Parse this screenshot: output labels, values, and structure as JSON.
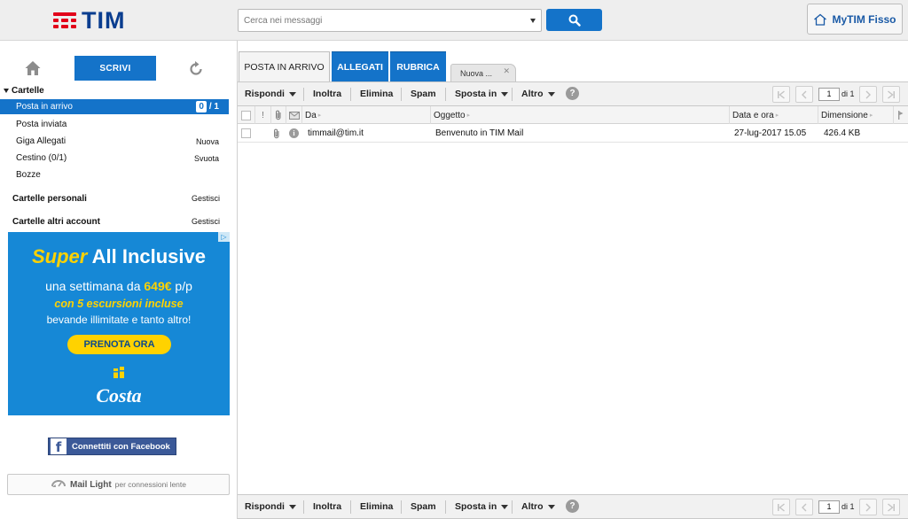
{
  "header": {
    "logo_text": "TIM",
    "search_placeholder": "Cerca nei messaggi",
    "mytim_label": "MyTIM Fisso",
    "brand_color": "#0a3d8f",
    "accent_color": "#1473c9"
  },
  "sidebar": {
    "write_label": "SCRIVI",
    "folders_title": "Cartelle",
    "folders": [
      {
        "label": "Posta in arrivo",
        "unread": "0",
        "total": "/ 1",
        "selected": true
      },
      {
        "label": "Posta inviata",
        "action": ""
      },
      {
        "label": "Giga Allegati",
        "action": "Nuova"
      },
      {
        "label": "Cestino (0/1)",
        "action": "Svuota"
      },
      {
        "label": "Bozze",
        "action": ""
      }
    ],
    "personal_folders": {
      "label": "Cartelle personali",
      "action": "Gestisci"
    },
    "other_accounts": {
      "label": "Cartelle altri account",
      "action": "Gestisci"
    },
    "ad": {
      "title_super": "Super",
      "title_rest": " All Inclusive",
      "line1_prefix": "una settimana da ",
      "line1_price": "649€",
      "line1_suffix": " p/p",
      "line2": "con 5 escursioni incluse",
      "line3": "bevande illimitate e tanto altro!",
      "cta": "PRENOTA ORA",
      "brand": "Costa",
      "adchoices": "▷"
    },
    "facebook_label": "Connettiti con Facebook",
    "mail_light_strong": "Mail Light",
    "mail_light_rest": "per connessioni lente"
  },
  "tabs": [
    {
      "label": "POSTA IN ARRIVO",
      "active": true
    },
    {
      "label": "ALLEGATI"
    },
    {
      "label": "RUBRICA"
    },
    {
      "label": "Nuova ..."
    }
  ],
  "toolbar": {
    "reply": "Rispondi",
    "forward": "Inoltra",
    "delete": "Elimina",
    "spam": "Spam",
    "move": "Sposta in",
    "more": "Altro",
    "help": "?",
    "page_current": "1",
    "page_total": "di 1"
  },
  "columns": {
    "priority": "!",
    "from": "Da",
    "subject": "Oggetto",
    "date": "Data e ora",
    "size": "Dimensione"
  },
  "messages": [
    {
      "from": "timmail@tim.it",
      "subject": "Benvenuto in TIM Mail",
      "date": "27-lug-2017 15.05",
      "size": "426.4 KB"
    }
  ]
}
